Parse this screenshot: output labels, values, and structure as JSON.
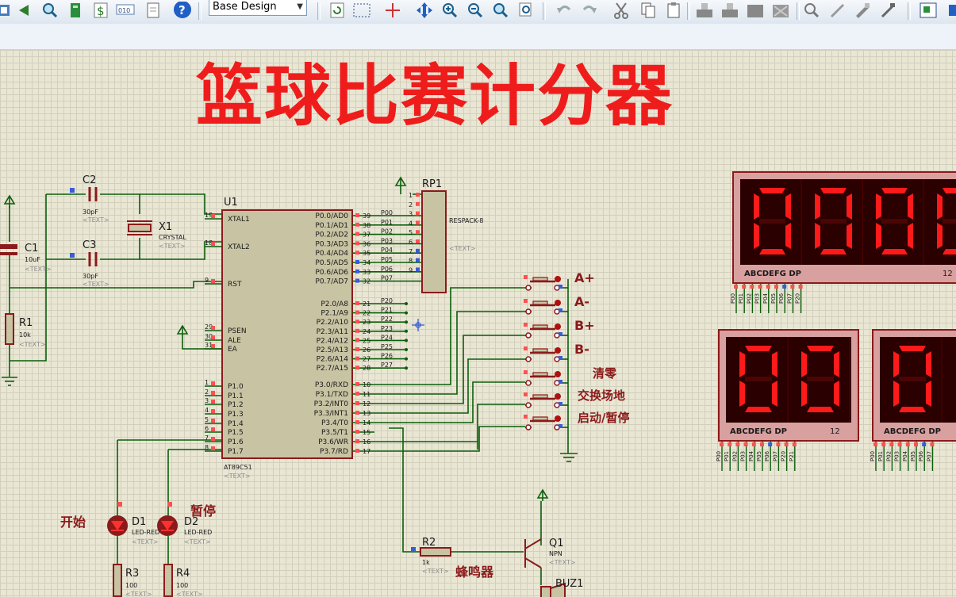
{
  "toolbar": {
    "layer_select": "Base Design",
    "icons": [
      "select-mode-icon",
      "playback-icon",
      "zoom-icon",
      "component-icon",
      "dollar-icon",
      "binary-icon",
      "document-icon",
      "help-icon",
      "refresh-icon",
      "grid-icon",
      "origin-icon",
      "pan-icon",
      "zoom-in-icon",
      "zoom-out-icon",
      "zoom-all-icon",
      "zoom-area-icon",
      "undo-icon",
      "redo-icon",
      "cut-icon",
      "copy-icon",
      "paste-icon",
      "block-copy-icon",
      "block-move-icon",
      "block-rotate-icon",
      "block-delete-icon",
      "pick-icon",
      "make-device-icon",
      "packaging-icon",
      "decompose-icon",
      "wire-autorouter-icon"
    ]
  },
  "schematic": {
    "title": "篮球比赛计分器",
    "mcu": {
      "ref": "U1",
      "part": "AT89C51",
      "text": "<TEXT>",
      "left_pins": [
        {
          "num": "19",
          "name": "XTAL1"
        },
        {
          "num": "18",
          "name": "XTAL2"
        },
        {
          "num": "9",
          "name": "RST"
        },
        {
          "num": "29",
          "name": "PSEN"
        },
        {
          "num": "30",
          "name": "ALE"
        },
        {
          "num": "31",
          "name": "EA"
        },
        {
          "num": "1",
          "name": "P1.0"
        },
        {
          "num": "2",
          "name": "P1.1"
        },
        {
          "num": "3",
          "name": "P1.2"
        },
        {
          "num": "4",
          "name": "P1.3"
        },
        {
          "num": "5",
          "name": "P1.4"
        },
        {
          "num": "6",
          "name": "P1.5"
        },
        {
          "num": "7",
          "name": "P1.6"
        },
        {
          "num": "8",
          "name": "P1.7"
        }
      ],
      "p0_pins": [
        {
          "name": "P0.0/AD0",
          "num": "39",
          "net": "P00"
        },
        {
          "name": "P0.1/AD1",
          "num": "38",
          "net": "P01"
        },
        {
          "name": "P0.2/AD2",
          "num": "37",
          "net": "P02"
        },
        {
          "name": "P0.3/AD3",
          "num": "36",
          "net": "P03"
        },
        {
          "name": "P0.4/AD4",
          "num": "35",
          "net": "P04"
        },
        {
          "name": "P0.5/AD5",
          "num": "34",
          "net": "P05"
        },
        {
          "name": "P0.6/AD6",
          "num": "33",
          "net": "P06"
        },
        {
          "name": "P0.7/AD7",
          "num": "32",
          "net": "P07"
        }
      ],
      "p2_pins": [
        {
          "name": "P2.0/A8",
          "num": "21",
          "net": "P20"
        },
        {
          "name": "P2.1/A9",
          "num": "22",
          "net": "P21"
        },
        {
          "name": "P2.2/A10",
          "num": "23",
          "net": "P22"
        },
        {
          "name": "P2.3/A11",
          "num": "24",
          "net": "P23"
        },
        {
          "name": "P2.4/A12",
          "num": "25",
          "net": "P24"
        },
        {
          "name": "P2.5/A13",
          "num": "26",
          "net": "P25"
        },
        {
          "name": "P2.6/A14",
          "num": "27",
          "net": "P26"
        },
        {
          "name": "P2.7/A15",
          "num": "28",
          "net": "P27"
        }
      ],
      "p3_pins": [
        {
          "name": "P3.0/RXD",
          "num": "10"
        },
        {
          "name": "P3.1/TXD",
          "num": "11"
        },
        {
          "name": "P3.2/INT0",
          "num": "12"
        },
        {
          "name": "P3.3/INT1",
          "num": "13"
        },
        {
          "name": "P3.4/T0",
          "num": "14"
        },
        {
          "name": "P3.5/T1",
          "num": "15"
        },
        {
          "name": "P3.6/WR",
          "num": "16"
        },
        {
          "name": "P3.7/RD",
          "num": "17"
        }
      ]
    },
    "rp1": {
      "ref": "RP1",
      "part": "RESPACK-8",
      "text": "<TEXT>",
      "pins": [
        "1",
        "2",
        "3",
        "4",
        "5",
        "6",
        "7",
        "8",
        "9"
      ]
    },
    "c1": {
      "ref": "C1",
      "value": "10uF",
      "text": "<TEXT>"
    },
    "c2": {
      "ref": "C2",
      "value": "30pF",
      "text": "<TEXT>"
    },
    "c3": {
      "ref": "C3",
      "value": "30pF",
      "text": "<TEXT>"
    },
    "x1": {
      "ref": "X1",
      "part": "CRYSTAL",
      "text": "<TEXT>"
    },
    "r1": {
      "ref": "R1",
      "value": "10k",
      "text": "<TEXT>"
    },
    "r2": {
      "ref": "R2",
      "value": "1k",
      "text": "<TEXT>"
    },
    "r3": {
      "ref": "R3",
      "value": "100",
      "text": "<TEXT>"
    },
    "r4": {
      "ref": "R4",
      "value": "100",
      "text": "<TEXT>"
    },
    "d1": {
      "ref": "D1",
      "part": "LED-RED",
      "text": "<TEXT>",
      "caption": "开始"
    },
    "d2": {
      "ref": "D2",
      "part": "LED-RED",
      "text": "<TEXT>",
      "caption": "暂停"
    },
    "q1": {
      "ref": "Q1",
      "part": "NPN",
      "text": "<TEXT>"
    },
    "buz": {
      "ref": "BUZ1",
      "caption": "蜂鸣器"
    },
    "buttons": [
      "A+",
      "A-",
      "B+",
      "B-",
      "清零",
      "交换场地",
      "启动/暂停"
    ],
    "displays": {
      "top": {
        "digits": [
          "0",
          "0",
          "0",
          "0"
        ],
        "seg_label": "ABCDEFG  DP",
        "pin_label": "12",
        "pin_tags": [
          "P00",
          "P01",
          "P02",
          "P03",
          "P04",
          "P05",
          "P06",
          "P07",
          "P20"
        ]
      },
      "left": {
        "digits": [
          "0",
          "0"
        ],
        "seg_label": "ABCDEFG  DP",
        "pin_label": "12",
        "pin_tags": [
          "P00",
          "P01",
          "P02",
          "P03",
          "P04",
          "P05",
          "P06",
          "P07",
          "P20",
          "P21"
        ]
      },
      "right": {
        "digits": [
          "0"
        ],
        "seg_label": "ABCDEFG  DP",
        "pin_tags": [
          "P00",
          "P01",
          "P02",
          "P03",
          "P04",
          "P05",
          "P06",
          "P07"
        ]
      }
    },
    "colors": {
      "wire": "#0b5f0b",
      "body": "#c8c3a3",
      "outline": "#8b1a1a",
      "digit_on": "#ff1a1a",
      "digit_bg": "#2a0000",
      "frame": "#d9a0a0",
      "title": "#ef1c1c"
    }
  }
}
